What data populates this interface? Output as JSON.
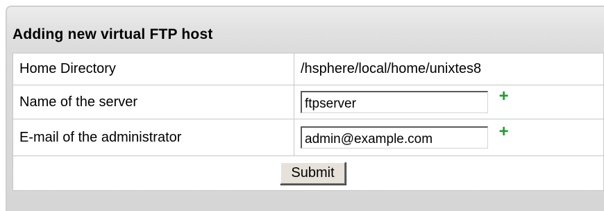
{
  "form": {
    "title": "Adding new virtual FTP host",
    "rows": [
      {
        "label": "Home Directory",
        "value": "/hsphere/local/home/unixtes8"
      },
      {
        "label": "Name of the server",
        "input_value": "ftpserver",
        "required_mark": "+",
        "required_icon": "plus-icon"
      },
      {
        "label": "E-mail of the administrator",
        "input_value": "admin@example.com",
        "required_mark": "+",
        "required_icon": "plus-icon"
      }
    ],
    "submit_label": "Submit"
  },
  "colors": {
    "required_mark": "#1f9e2e",
    "panel_background": "#dcdcdc",
    "table_border": "#c6c6c6"
  }
}
